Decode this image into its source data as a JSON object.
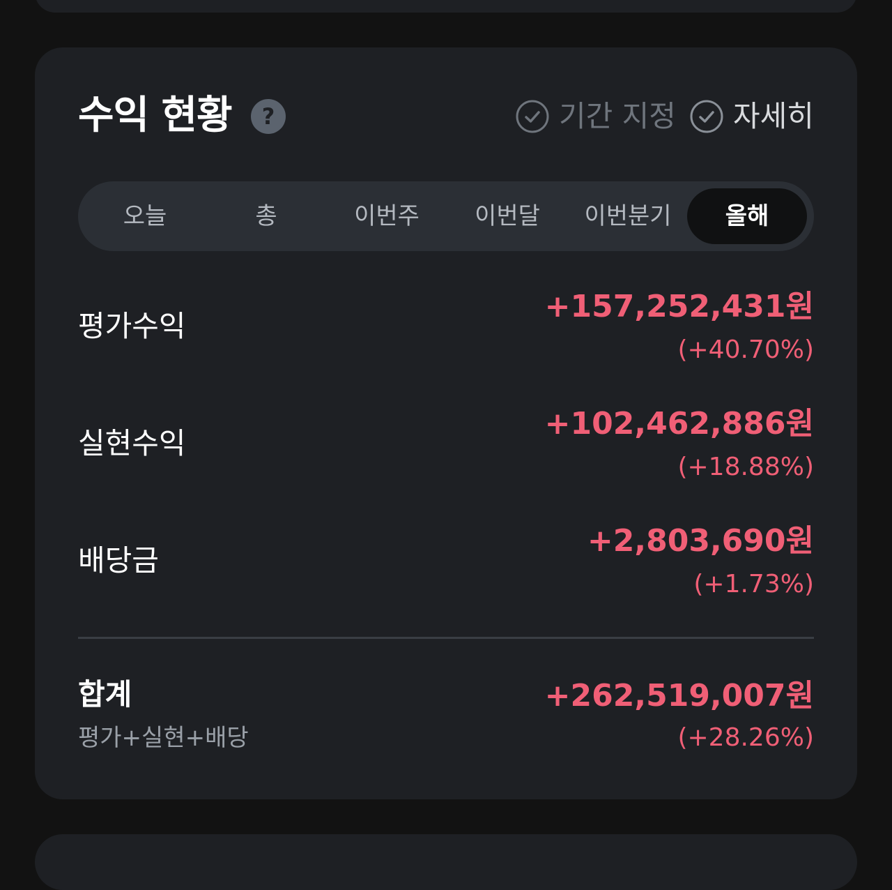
{
  "header": {
    "title": "수익 현황",
    "help_icon": "?",
    "period_option": "기간 지정",
    "detail_option": "자세히"
  },
  "tabs": [
    {
      "label": "오늘",
      "active": false
    },
    {
      "label": "총",
      "active": false
    },
    {
      "label": "이번주",
      "active": false
    },
    {
      "label": "이번달",
      "active": false
    },
    {
      "label": "이번분기",
      "active": false
    },
    {
      "label": "올해",
      "active": true
    }
  ],
  "rows": [
    {
      "label": "평가수익",
      "amount": "+157,252,431원",
      "percent": "(+40.70%)"
    },
    {
      "label": "실현수익",
      "amount": "+102,462,886원",
      "percent": "(+18.88%)"
    },
    {
      "label": "배당금",
      "amount": "+2,803,690원",
      "percent": "(+1.73%)"
    }
  ],
  "total": {
    "label": "합계",
    "sublabel": "평가+실현+배당",
    "amount": "+262,519,007원",
    "percent": "(+28.26%)"
  },
  "colors": {
    "background": "#121212",
    "card": "#1e2024",
    "profit": "#f05f76",
    "tab_bar": "#2b2f35",
    "tab_active": "#101112"
  },
  "icons": {
    "help": "question-circle-icon",
    "check": "check-circle-icon"
  }
}
